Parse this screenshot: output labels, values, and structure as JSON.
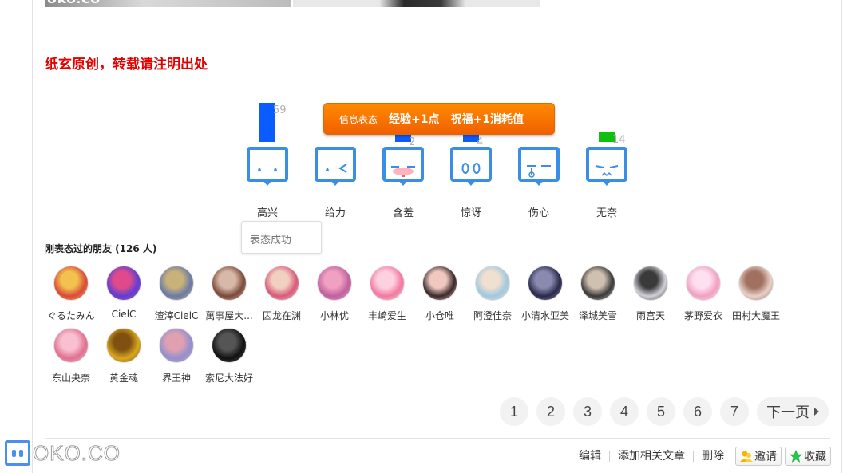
{
  "top_watermark": "OKO.CO",
  "copyright_note": "纸玄原创，转载请注明出处",
  "reactions": [
    {
      "label": "高兴",
      "count": "59",
      "level": 59,
      "icon": "happy-face-icon",
      "color": "#0b5cff"
    },
    {
      "label": "给力",
      "count": "",
      "level": 0,
      "icon": "wink-face-icon",
      "color": "#0b5cff"
    },
    {
      "label": "含羞",
      "count": "2",
      "level": 2,
      "icon": "shy-face-icon",
      "color": "#0b5cff"
    },
    {
      "label": "惊讶",
      "count": "4",
      "level": 4,
      "icon": "surprised-face-icon",
      "color": "#0b5cff"
    },
    {
      "label": "伤心",
      "count": "",
      "level": 0,
      "icon": "sad-face-icon",
      "color": "#0b5cff"
    },
    {
      "label": "无奈",
      "count": "14",
      "level": 14,
      "icon": "helpless-face-icon",
      "color": "#10c010"
    }
  ],
  "toast": {
    "part1": "信息表态",
    "part2": "经验+1点",
    "part3": "祝福+1消耗值"
  },
  "tooltip": "表态成功",
  "friends_heading": "刚表态过的朋友 (126 人)",
  "friends": [
    {
      "name": "ぐるたみん"
    },
    {
      "name": "CielC"
    },
    {
      "name": "渣滓CielC"
    },
    {
      "name": "萬事屋大..."
    },
    {
      "name": "囚龙在渊"
    },
    {
      "name": "小林优"
    },
    {
      "name": "丰崎爱生"
    },
    {
      "name": "小仓唯"
    },
    {
      "name": "阿澄佳奈"
    },
    {
      "name": "小清水亚美"
    },
    {
      "name": "泽城美雪"
    },
    {
      "name": "雨宫天"
    },
    {
      "name": "茅野爱衣"
    },
    {
      "name": "田村大魔王"
    },
    {
      "name": "东山央奈"
    },
    {
      "name": "黄金魂"
    },
    {
      "name": "界王神"
    },
    {
      "name": "索尼大法好"
    }
  ],
  "pagination": {
    "pages": [
      "1",
      "2",
      "3",
      "4",
      "5",
      "6",
      "7"
    ],
    "next_label": "下一页"
  },
  "logo_text": "OKO.CO",
  "footer": {
    "edit": "编辑",
    "add_related": "添加相关文章",
    "delete": "删除",
    "invite": "邀请",
    "favorite": "收藏"
  }
}
